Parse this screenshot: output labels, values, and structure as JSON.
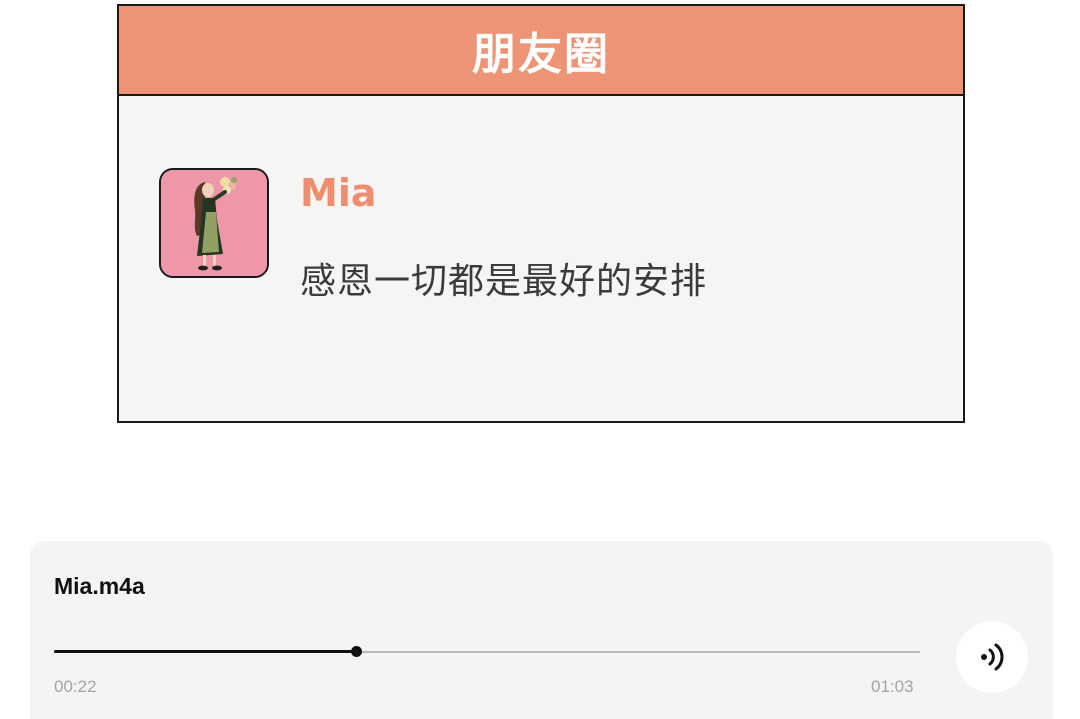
{
  "moments": {
    "title": "朋友圈",
    "post": {
      "username": "Mia",
      "text": "感恩一切都是最好的安排"
    }
  },
  "player": {
    "file_name": "Mia.m4a",
    "elapsed": "00:22",
    "total": "01:03",
    "progress_fraction": 0.349,
    "speaker_icon": "speaker-icon"
  },
  "colors": {
    "header_bg": "#ee9476",
    "username": "#ec8e6f",
    "avatar_bg": "#ee97a9"
  }
}
